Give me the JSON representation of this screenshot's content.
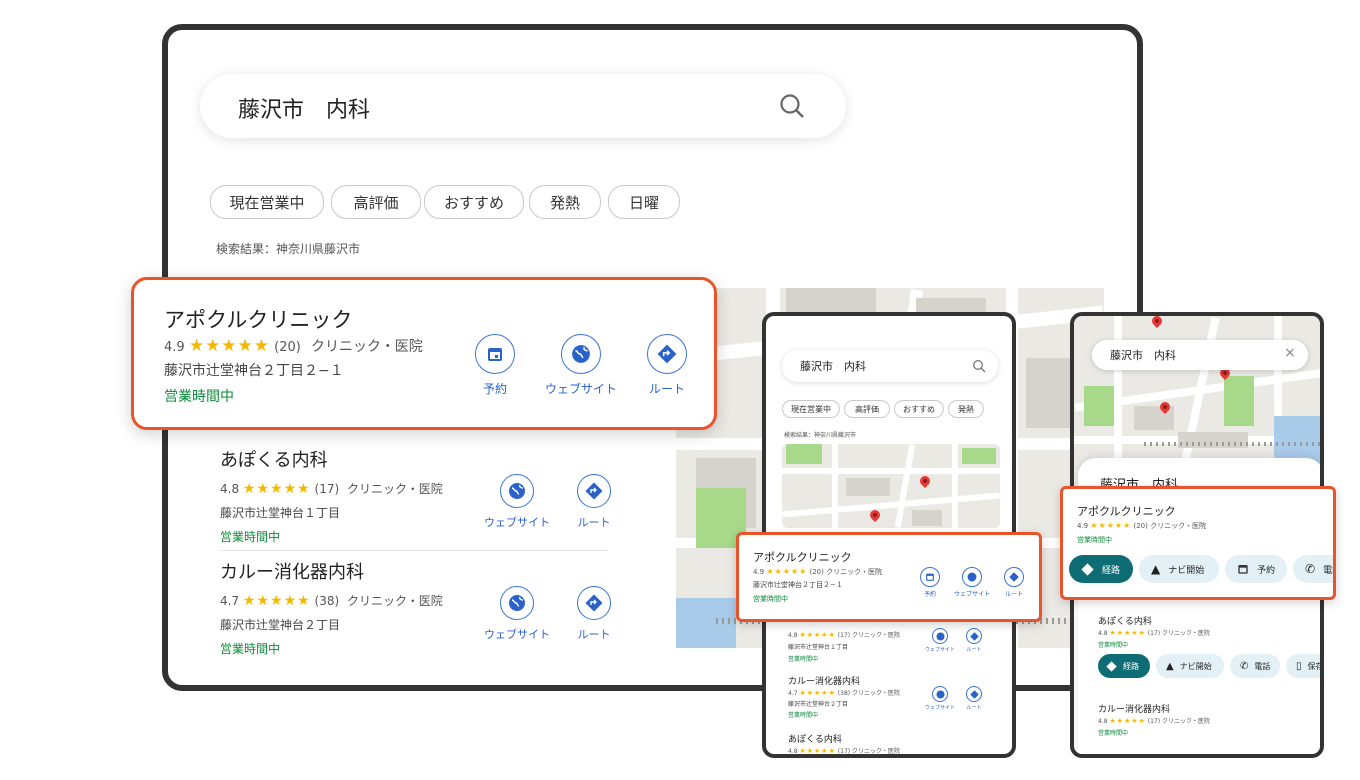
{
  "tablet": {
    "search": {
      "query": "藤沢市　内科"
    },
    "chips": [
      "現在営業中",
      "高評価",
      "おすすめ",
      "発熱",
      "日曜"
    ],
    "results_label": "検索結果：神奈川県藤沢市",
    "featured": {
      "name": "アポクルクリニック",
      "rating": "4.9",
      "stars": "★★★★★",
      "count": "(20)",
      "category": "クリニック・医院",
      "address": "藤沢市辻堂神台２丁目２−１",
      "status": "営業時間中",
      "actions": [
        "予約",
        "ウェブサイト",
        "ルート"
      ]
    },
    "results": [
      {
        "name": "あぽくる内科",
        "rating": "4.8",
        "stars": "★★★★★",
        "count": "(17)",
        "category": "クリニック・医院",
        "address": "藤沢市辻堂神台１丁目",
        "status": "営業時間中",
        "actions": [
          "ウェブサイト",
          "ルート"
        ]
      },
      {
        "name": "カルー消化器内科",
        "rating": "4.7",
        "stars": "★★★★★",
        "count": "(38)",
        "category": "クリニック・医院",
        "address": "藤沢市辻堂神台２丁目",
        "status": "営業時間中",
        "actions": [
          "ウェブサイト",
          "ルート"
        ]
      }
    ]
  },
  "phone1": {
    "search": {
      "query": "藤沢市　内科"
    },
    "chips": [
      "現在営業中",
      "高評価",
      "おすすめ",
      "発熱"
    ],
    "results_label": "検索結果：神奈川県藤沢市",
    "featured": {
      "name": "アポクルクリニック",
      "rating": "4.9",
      "stars": "★★★★★",
      "count": "(20)",
      "category": "クリニック・医院",
      "address": "藤沢市辻堂神台２丁目２−１",
      "status": "営業時間中",
      "actions": [
        "予約",
        "ウェブサイト",
        "ルート"
      ]
    },
    "results": [
      {
        "name": "",
        "rating": "4.8",
        "stars": "★★★★★",
        "count": "(17)",
        "category": "クリニック・医院",
        "address": "藤沢市辻堂神台１丁目",
        "status": "営業時間中",
        "actions": [
          "ウェブサイト",
          "ルート"
        ]
      },
      {
        "name": "カルー消化器内科",
        "rating": "4.7",
        "stars": "★★★★★",
        "count": "(38)",
        "category": "クリニック・医院",
        "address": "藤沢市辻堂神台２丁目",
        "status": "営業時間中",
        "actions": [
          "ウェブサイト",
          "ルート"
        ]
      },
      {
        "name": "あぽくる内科",
        "rating": "4.8",
        "stars": "★★★★★",
        "count": "(17)",
        "category": "クリニック・医院"
      }
    ]
  },
  "phone2": {
    "search": {
      "query": "藤沢市　内科"
    },
    "sheet_title": "藤沢市　内科",
    "featured": {
      "name": "アポクルクリニック",
      "rating": "4.9",
      "stars": "★★★★★",
      "count": "(20)",
      "category": "クリニック・医院",
      "status": "営業時間中",
      "actions": [
        "経路",
        "ナビ開始",
        "予約",
        "電話"
      ]
    },
    "results": [
      {
        "name": "あぽくる内科",
        "rating": "4.8",
        "stars": "★★★★★",
        "count": "(17)",
        "category": "クリニック・医院",
        "status": "営業時間中",
        "actions": [
          "経路",
          "ナビ開始",
          "電話",
          "保存"
        ]
      },
      {
        "name": "カルー消化器内科",
        "rating": "4.8",
        "stars": "★★★★★",
        "count": "(17)",
        "category": "クリニック・医院",
        "status": "営業時間中"
      }
    ]
  },
  "colors": {
    "accent": "#e8552b",
    "link": "#2962c9",
    "open": "#0d8a3a",
    "teal": "#0e6d74",
    "frame": "#333333"
  }
}
